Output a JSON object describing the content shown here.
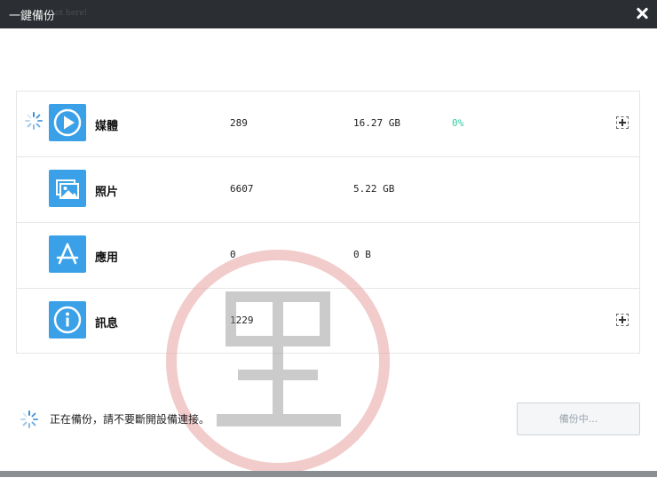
{
  "window": {
    "title": "一鍵備份",
    "ghost_text": "ot here!"
  },
  "categories": [
    {
      "name": "媒體",
      "icon": "play-icon",
      "count": "289",
      "size": "16.27 GB",
      "progress": "0%",
      "loading": true,
      "expandable": true
    },
    {
      "name": "照片",
      "icon": "photo-icon",
      "count": "6607",
      "size": "5.22 GB",
      "progress": "",
      "loading": false,
      "expandable": false
    },
    {
      "name": "應用",
      "icon": "app-store-icon",
      "count": "0",
      "size": "0 B",
      "progress": "",
      "loading": false,
      "expandable": false
    },
    {
      "name": "訊息",
      "icon": "info-icon",
      "count": "1229",
      "size": "",
      "progress": "",
      "loading": false,
      "expandable": true
    }
  ],
  "status": {
    "text": "正在備份，請不要斷開設備連接。"
  },
  "backup_button": {
    "label": "備份中..."
  },
  "colors": {
    "title_bar": "#2b2f33",
    "icon_blue": "#3aa1e8",
    "progress_green": "#3cc9a4",
    "watermark_red": "#e8a0a0"
  }
}
